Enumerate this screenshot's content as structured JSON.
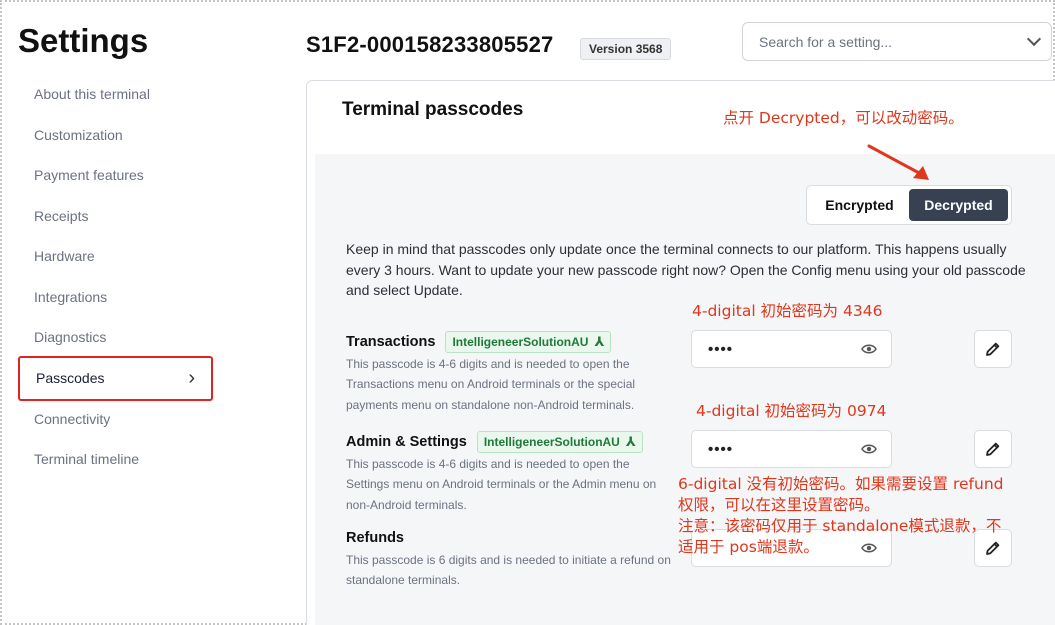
{
  "page": {
    "title": "Settings"
  },
  "sidebar": {
    "items": [
      {
        "label": "About this terminal"
      },
      {
        "label": "Customization"
      },
      {
        "label": "Payment features"
      },
      {
        "label": "Receipts"
      },
      {
        "label": "Hardware"
      },
      {
        "label": "Integrations"
      },
      {
        "label": "Diagnostics"
      },
      {
        "label": "Passcodes",
        "active": true
      },
      {
        "label": "Connectivity"
      },
      {
        "label": "Terminal timeline"
      }
    ]
  },
  "header": {
    "serial": "S1F2-000158233805527",
    "version": "Version 3568",
    "search_placeholder": "Search for a setting..."
  },
  "panel": {
    "title": "Terminal passcodes",
    "toggle": {
      "encrypted": "Encrypted",
      "decrypted": "Decrypted",
      "selected": "decrypted"
    },
    "info": "Keep in mind that passcodes only update once the terminal connects to our platform. This happens usually every 3 hours. Want to update your new passcode right now? Open the Config menu using your old passcode and select Update.",
    "rows": [
      {
        "label": "Transactions",
        "tag": "IntelligeneerSolutionAU",
        "description": "This passcode is 4-6 digits and is needed to open the Transactions menu on Android terminals or the special payments menu on standalone non-Android terminals.",
        "value": "••••"
      },
      {
        "label": "Admin & Settings",
        "tag": "IntelligeneerSolutionAU",
        "description": "This passcode is 4-6 digits and is needed to open the Settings menu on Android terminals or the Admin menu on non-Android terminals.",
        "value": "••••"
      },
      {
        "label": "Refunds",
        "description": "This passcode is 6 digits and is needed to initiate a refund on standalone terminals.",
        "value": ""
      }
    ]
  },
  "annotations": {
    "toggle_note": "点开 Decrypted，可以改动密码。",
    "transactions_note": "4-digital 初始密码为 4346",
    "admin_note": "4-digital 初始密码为 0974",
    "refunds_note_1": "6-digital 没有初始密码。如果需要设置 refund",
    "refunds_note_2": "权限，可以在这里设置密码。",
    "refunds_note_3": "注意：该密码仅用于 standalone模式退款，不",
    "refunds_note_4": "适用于 pos端退款。"
  },
  "colors": {
    "annotation": "#e0361b",
    "highlight_border": "#e02424",
    "toggle_selected": "#374151",
    "tag_green": "#1f7a3a"
  }
}
